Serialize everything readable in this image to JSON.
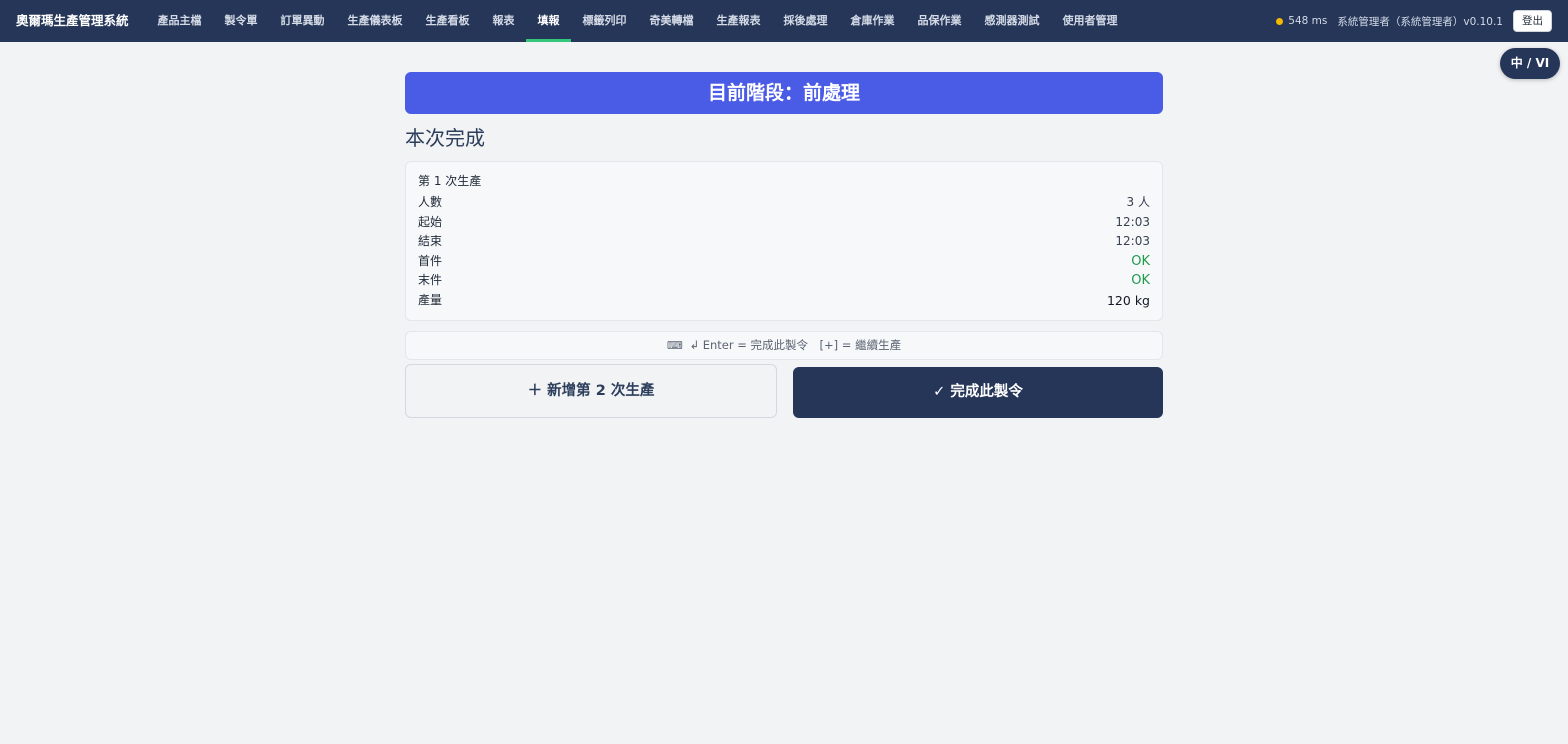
{
  "app": {
    "title": "奧爾瑪生產管理系統"
  },
  "nav": {
    "items": [
      {
        "label": "產品主檔",
        "active": false
      },
      {
        "label": "製令單",
        "active": false
      },
      {
        "label": "訂單異動",
        "active": false
      },
      {
        "label": "生產儀表板",
        "active": false
      },
      {
        "label": "生產看板",
        "active": false
      },
      {
        "label": "報表",
        "active": false
      },
      {
        "label": "填報",
        "active": true
      },
      {
        "label": "標籤列印",
        "active": false
      },
      {
        "label": "奇美轉檔",
        "active": false
      },
      {
        "label": "生產報表",
        "active": false
      },
      {
        "label": "採後處理",
        "active": false
      },
      {
        "label": "倉庫作業",
        "active": false
      },
      {
        "label": "品保作業",
        "active": false
      },
      {
        "label": "感測器測試",
        "active": false
      },
      {
        "label": "使用者管理",
        "active": false
      }
    ]
  },
  "status": {
    "latency": "548 ms",
    "user": "系統管理者（系統管理者）v0.10.1",
    "logout_label": "登出",
    "dot_color": "#f5b700"
  },
  "lang_toggle": "中 / VI",
  "stage": {
    "banner": "目前階段：前處理"
  },
  "section_title": "本次完成",
  "summary": {
    "run_title": "第 1 次生產",
    "rows": [
      {
        "label": "人數",
        "value": "3 人"
      },
      {
        "label": "起始",
        "value": "12:03"
      },
      {
        "label": "結束",
        "value": "12:03"
      },
      {
        "label": "首件",
        "value": "OK"
      },
      {
        "label": "末件",
        "value": "OK"
      },
      {
        "label": "產量",
        "value": "120 kg"
      }
    ]
  },
  "hint": {
    "icon": "⌨",
    "text": "↲ Enter = 完成此製令　[+] = 繼續生產"
  },
  "buttons": {
    "add_label": "＋ 新增第 2 次生產",
    "complete_label": "✓ 完成此製令"
  },
  "colors": {
    "navbar": "#253659",
    "banner": "#4a5ce6",
    "active_underline": "#34c77b",
    "ok": "#1e9a4c"
  }
}
